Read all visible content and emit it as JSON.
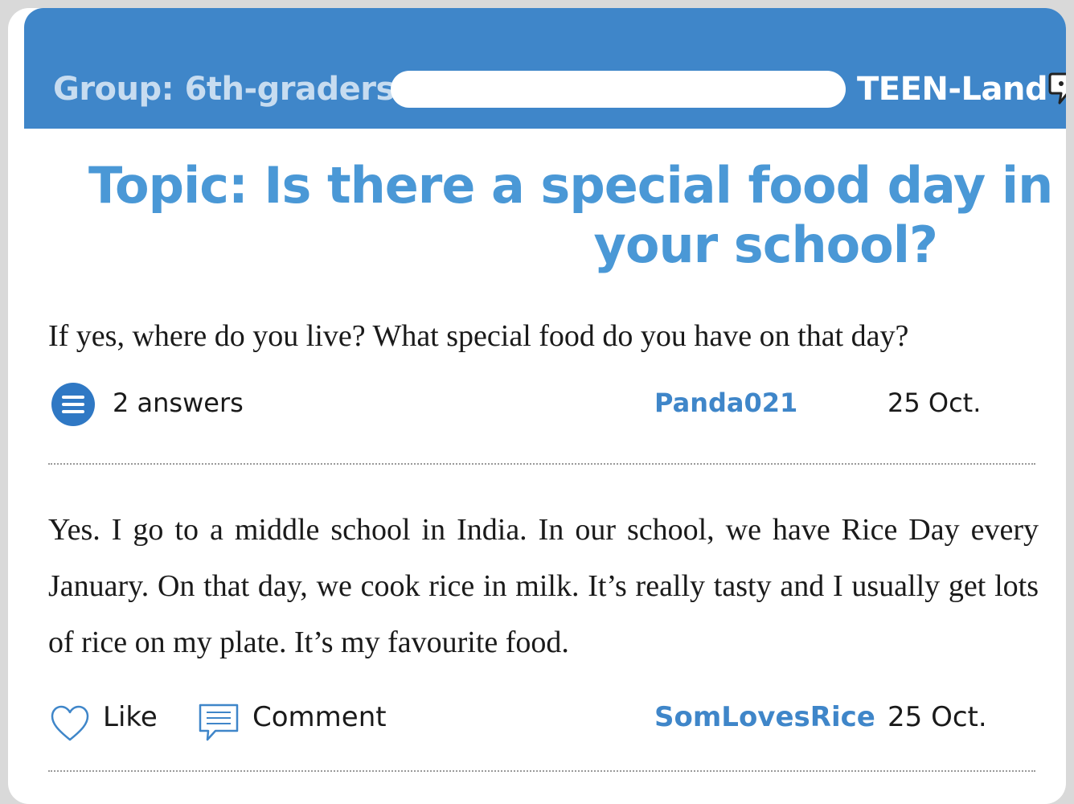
{
  "header": {
    "group_label": "Group: 6th-graders",
    "search_value": "",
    "brand": "TEEN-Land",
    "brand_icon": "speech-bubble-icon",
    "colors": {
      "bar": "#3f86c9",
      "topic": "#4a98d6",
      "author": "#3f86c9"
    }
  },
  "topic": {
    "line1": "Topic:  Is there a special food day in",
    "line2": "your school?"
  },
  "question": {
    "text": "If yes, where do you live? What special food do you have on that day?",
    "answers_count": "2 answers",
    "answers_icon": "list-icon",
    "author": "Panda021",
    "date": "25 Oct."
  },
  "answer": {
    "text": "Yes. I go to a middle school in India. In our school, we have Rice Day every January. On that day, we cook rice in milk. It’s really tasty and I usually get lots of rice on my plate. It’s my favourite food.",
    "like_label": "Like",
    "like_icon": "heart-icon",
    "comment_label": "Comment",
    "comment_icon": "comment-icon",
    "author": "SomLovesRice",
    "date": "25 Oct."
  }
}
